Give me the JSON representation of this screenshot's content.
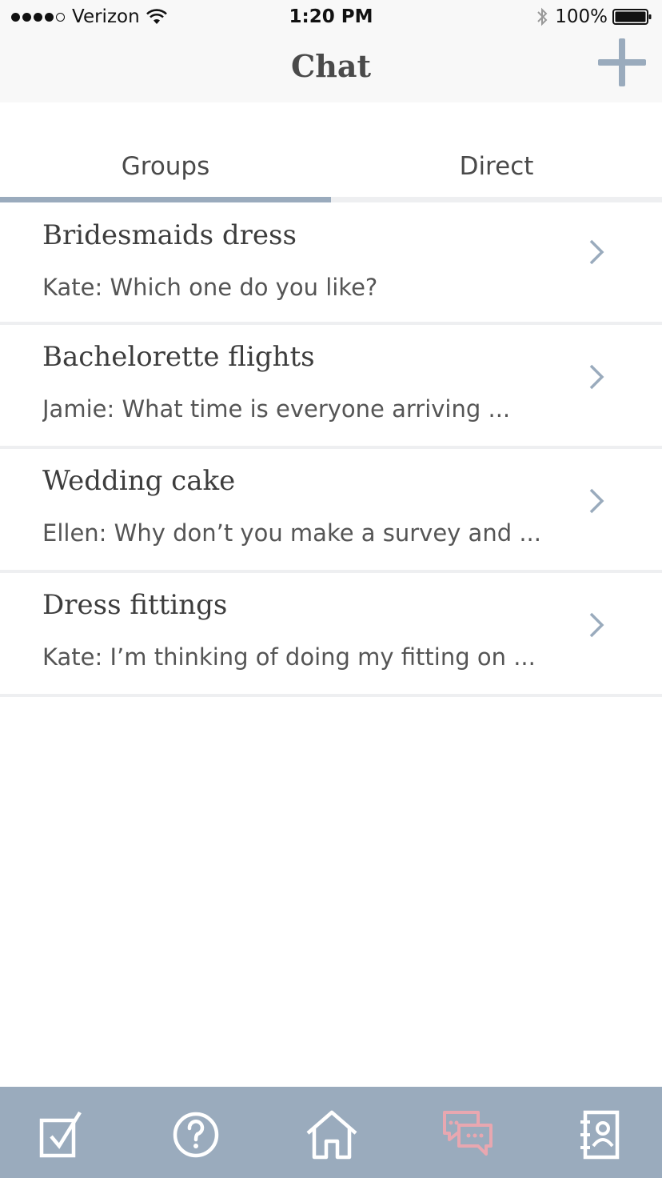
{
  "status_bar": {
    "carrier": "Verizon",
    "time": "1:20 PM",
    "battery": "100%",
    "icons": [
      "signal-icon",
      "wifi-icon",
      "bluetooth-icon",
      "battery-icon"
    ]
  },
  "header": {
    "title": "Chat",
    "add_icon": "plus-icon"
  },
  "tabs": [
    {
      "label": "Groups",
      "active": true
    },
    {
      "label": "Direct",
      "active": false
    }
  ],
  "chats": [
    {
      "title": "Bridesmaids dress",
      "preview": "Kate: Which one do you like?"
    },
    {
      "title": "Bachelorette flights",
      "preview": "Jamie: What time is everyone arriving ..."
    },
    {
      "title": "Wedding cake",
      "preview": "Ellen: Why don’t you make a survey and ..."
    },
    {
      "title": "Dress fittings",
      "preview": "Kate: I’m thinking of doing my fitting on ..."
    }
  ],
  "tab_bar": {
    "items": [
      {
        "icon": "checkbox-icon",
        "active": false
      },
      {
        "icon": "question-icon",
        "active": false
      },
      {
        "icon": "home-icon",
        "active": false
      },
      {
        "icon": "chat-icon",
        "active": true
      },
      {
        "icon": "contacts-icon",
        "active": false
      }
    ]
  },
  "colors": {
    "accent": "#9aabbd",
    "active_tab_icon": "#e8a7b0",
    "header_bg": "#f8f8f8",
    "divider": "#eeeff1"
  }
}
